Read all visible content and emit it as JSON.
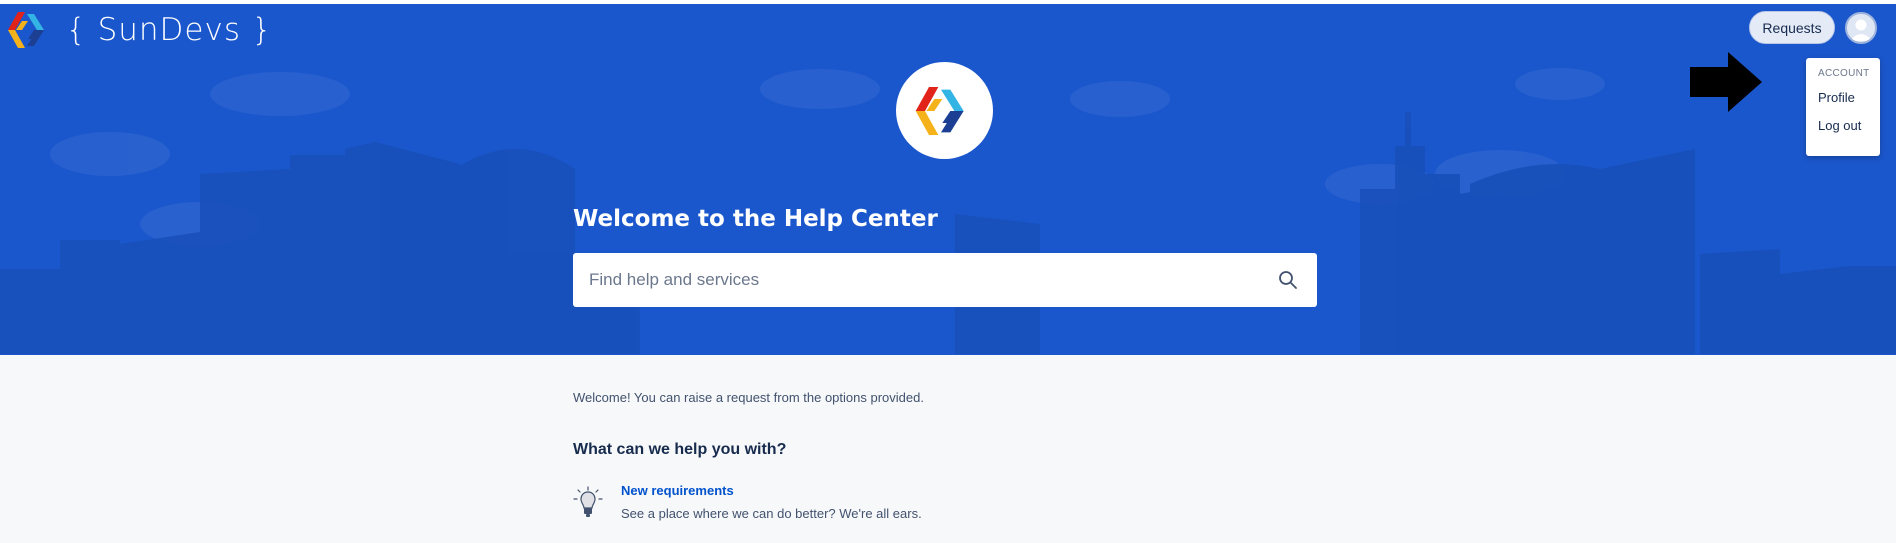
{
  "header": {
    "brand_text": "{ SunDevs }",
    "requests_label": "Requests"
  },
  "account_menu": {
    "heading": "ACCOUNT",
    "items": [
      {
        "label": "Profile"
      },
      {
        "label": "Log out"
      }
    ]
  },
  "hero": {
    "title": "Welcome to the Help Center",
    "search_placeholder": "Find help and services"
  },
  "main": {
    "intro": "Welcome! You can raise a request from the options provided.",
    "help_heading": "What can we help you with?",
    "request_types": [
      {
        "title": "New requirements",
        "description": "See a place where we can do better? We're all ears.",
        "icon": "lightbulb-icon"
      }
    ]
  },
  "colors": {
    "hero_background": "#1b57cc",
    "link": "#0052cc",
    "logo_red": "#e2231a",
    "logo_yellow": "#f6b21b",
    "logo_cyan": "#34b4e4",
    "logo_navy": "#1c3f94"
  }
}
